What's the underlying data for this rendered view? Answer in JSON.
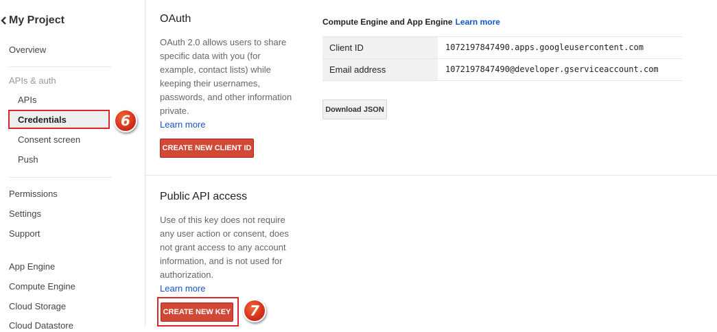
{
  "sidebar": {
    "project_title": "My Project",
    "overview": "Overview",
    "apis_auth_heading": "APIs & auth",
    "apis": "APIs",
    "credentials": "Credentials",
    "consent_screen": "Consent screen",
    "push": "Push",
    "permissions": "Permissions",
    "settings": "Settings",
    "support": "Support",
    "app_engine": "App Engine",
    "compute_engine": "Compute Engine",
    "cloud_storage": "Cloud Storage",
    "cloud_datastore": "Cloud Datastore"
  },
  "markers": {
    "step6": "6",
    "step7": "7"
  },
  "oauth": {
    "title": "OAuth",
    "description": "OAuth 2.0 allows users to share specific data with you (for example, contact lists) while keeping their usernames, passwords, and other information private.",
    "learn_more": "Learn more",
    "button": "CREATE NEW CLIENT ID"
  },
  "credentials_panel": {
    "heading": "Compute Engine and App Engine",
    "learn_more": "Learn more",
    "rows": [
      {
        "label": "Client ID",
        "value": "1072197847490.apps.googleusercontent.com"
      },
      {
        "label": "Email address",
        "value": "1072197847490@developer.gserviceaccount.com"
      }
    ],
    "download_button": "Download JSON"
  },
  "public_api": {
    "title": "Public API access",
    "description": "Use of this key does not require any user action or consent, does not grant access to any account information, and is not used for authorization.",
    "learn_more": "Learn more",
    "button": "CREATE NEW KEY"
  },
  "colors": {
    "accent_red": "#d14836",
    "highlight_red": "#d9262b",
    "link_blue": "#1155cc"
  }
}
